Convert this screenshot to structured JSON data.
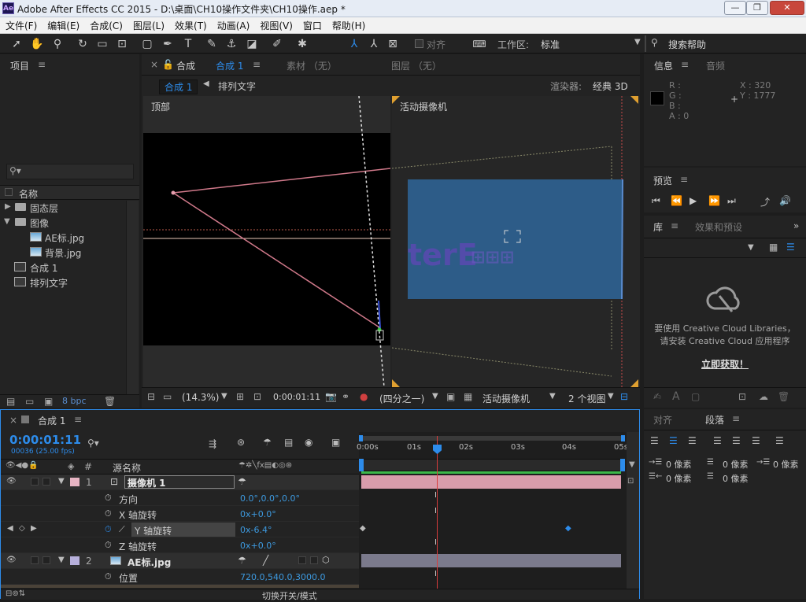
{
  "window": {
    "title": "Adobe After Effects CC 2015 - D:\\桌面\\CH10操作文件夹\\CH10操作.aep *",
    "app_badge": "Ae",
    "min": "—",
    "max": "❐",
    "close": "✕"
  },
  "menu": [
    "文件(F)",
    "编辑(E)",
    "合成(C)",
    "图层(L)",
    "效果(T)",
    "动画(A)",
    "视图(V)",
    "窗口",
    "帮助(H)"
  ],
  "toolbar": {
    "align_label": "对齐",
    "workspace_label": "工作区:",
    "workspace_value": "标准",
    "search_help": "搜索帮助"
  },
  "project": {
    "tab": "项目",
    "search_placeholder": "",
    "col_name": "名称",
    "items": [
      {
        "label": "固态层",
        "type": "folder",
        "expanded": false
      },
      {
        "label": "图像",
        "type": "folder",
        "expanded": true
      },
      {
        "label": "AE标.jpg",
        "type": "image"
      },
      {
        "label": "背景.jpg",
        "type": "image"
      },
      {
        "label": "合成 1",
        "type": "comp"
      },
      {
        "label": "排列文字",
        "type": "comp"
      }
    ],
    "bpc": "8 bpc"
  },
  "viewer": {
    "tab_comp_prefix": "合成",
    "tab_comp_name": "合成 1",
    "tab_footage": "素材 （无）",
    "tab_layer": "图层 （无）",
    "breadcrumb_active": "合成 1",
    "breadcrumb_next": "排列文字",
    "renderer_label": "渲染器:",
    "renderer_value": "经典 3D",
    "left_view_label": "顶部",
    "right_view_label": "活动摄像机",
    "zoom": "(14.3%)",
    "timecode": "0:00:01:11",
    "resolution": "(四分之一)",
    "camera": "活动摄像机",
    "views": "2 个视图"
  },
  "info": {
    "tab": "信息",
    "tab2": "音频",
    "r": "R :",
    "g": "G :",
    "b": "B :",
    "a": "A : 0",
    "x": "X : 320",
    "y": "Y : 1777"
  },
  "preview": {
    "tab": "预览"
  },
  "library": {
    "tab": "库",
    "tab2": "效果和预设",
    "msg1": "要使用 Creative Cloud Libraries，",
    "msg2": "请安装 Creative Cloud 应用程序",
    "link": "立即获取！"
  },
  "paragraph": {
    "tab1": "对齐",
    "tab2": "段落",
    "px": "0 像素"
  },
  "timeline": {
    "tab": "合成 1",
    "timecode": "0:00:01:11",
    "frames": "00036 (25.00 fps)",
    "col_num": "#",
    "col_name": "源名称",
    "ruler": [
      "0:00s",
      "01s",
      "02s",
      "03s",
      "04s",
      "05s"
    ],
    "layers": [
      {
        "num": "1",
        "name": "摄像机 1",
        "color": "#e7b4c3"
      },
      {
        "num": "2",
        "name": "AE标.jpg",
        "color": "#b7b0db"
      }
    ],
    "props": [
      {
        "name": "方向",
        "value": "0.0°,0.0°,0.0°"
      },
      {
        "name": "X 轴旋转",
        "value": "0x+0.0°"
      },
      {
        "name": "Y 轴旋转",
        "value": "0x-6.4°"
      },
      {
        "name": "Z 轴旋转",
        "value": "0x+0.0°"
      },
      {
        "name": "位置",
        "value": "720.0,540.0,3000.0"
      }
    ],
    "footer": "切换开关/模式"
  },
  "colors": {
    "accent": "#2d8ceb",
    "camera_bar": "#d89cab",
    "image_bar": "#7b7a8c",
    "playhead": "#d83c3c"
  }
}
